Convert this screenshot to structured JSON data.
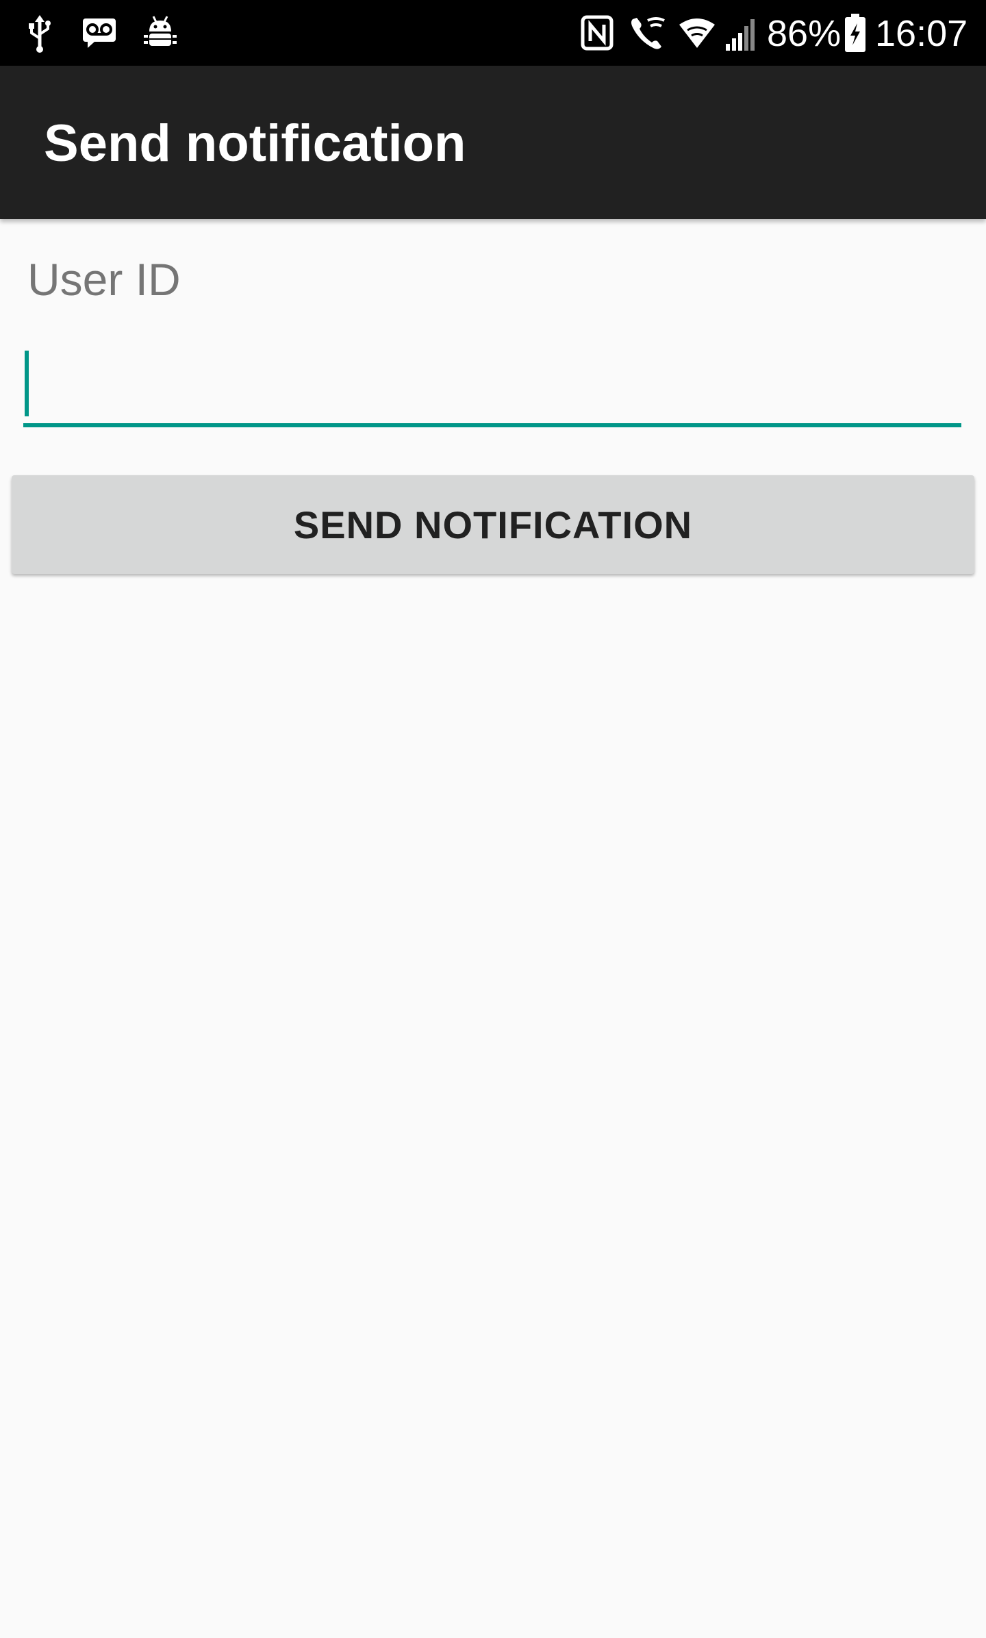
{
  "status_bar": {
    "left_icons": [
      "usb-icon",
      "voicemail-icon",
      "android-debug-icon"
    ],
    "right_icons": [
      "nfc-icon",
      "wifi-calling-icon",
      "wifi-icon",
      "signal-icon",
      "battery-charging-icon"
    ],
    "battery_percent": "86%",
    "time": "16:07"
  },
  "app_bar": {
    "title": "Send notification",
    "background_color": "#212121"
  },
  "form": {
    "user_id_label": "User ID",
    "user_id_value": "",
    "accent_color": "#009688"
  },
  "actions": {
    "send_label": "SEND NOTIFICATION"
  }
}
